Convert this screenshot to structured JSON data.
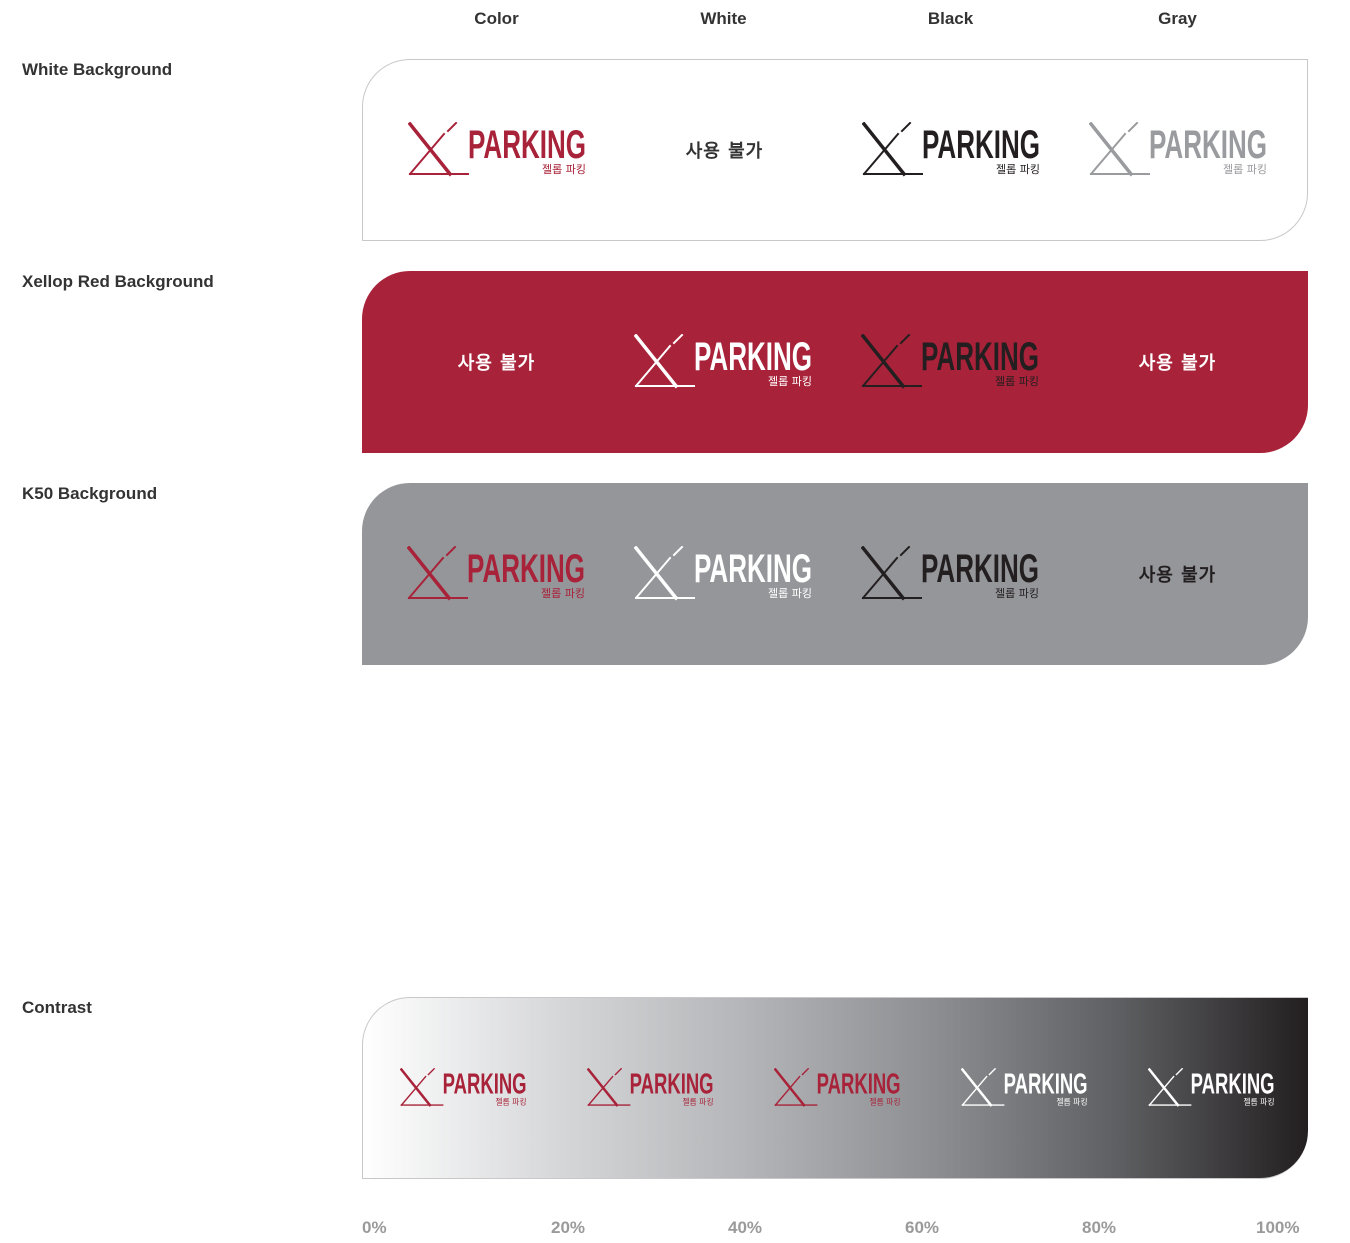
{
  "columns": [
    "Color",
    "White",
    "Black",
    "Gray"
  ],
  "logo": {
    "word": "PARKING",
    "sub": "젤롭 파킹"
  },
  "not_available": "사용 불가",
  "colors": {
    "red": "#a82239",
    "white": "#ffffff",
    "black": "#231f20",
    "gray": "#9a9b9e",
    "k50": "#95969a",
    "label": "#333333"
  },
  "rows": [
    {
      "label": "White Background",
      "background": "#ffffff",
      "cells": [
        {
          "type": "logo",
          "color": "#a82239"
        },
        {
          "type": "na",
          "text_color": "#333333"
        },
        {
          "type": "logo",
          "color": "#231f20"
        },
        {
          "type": "logo",
          "color": "#9a9b9e"
        }
      ]
    },
    {
      "label": "Xellop Red Background",
      "background": "#a82239",
      "cells": [
        {
          "type": "na",
          "text_color": "#ffffff"
        },
        {
          "type": "logo",
          "color": "#ffffff"
        },
        {
          "type": "logo",
          "color": "#231f20"
        },
        {
          "type": "na",
          "text_color": "#ffffff"
        }
      ]
    },
    {
      "label": "K50 Background",
      "background": "#95969a",
      "cells": [
        {
          "type": "logo",
          "color": "#a82239"
        },
        {
          "type": "logo",
          "color": "#ffffff"
        },
        {
          "type": "logo",
          "color": "#231f20"
        },
        {
          "type": "na",
          "text_color": "#231f20"
        }
      ]
    }
  ],
  "contrast": {
    "label": "Contrast",
    "ticks": [
      "0%",
      "20%",
      "40%",
      "60%",
      "80%",
      "100%"
    ],
    "logos": [
      {
        "color": "#a82239"
      },
      {
        "color": "#a82239"
      },
      {
        "color": "#a82239"
      },
      {
        "color": "#ffffff"
      },
      {
        "color": "#ffffff"
      }
    ]
  }
}
